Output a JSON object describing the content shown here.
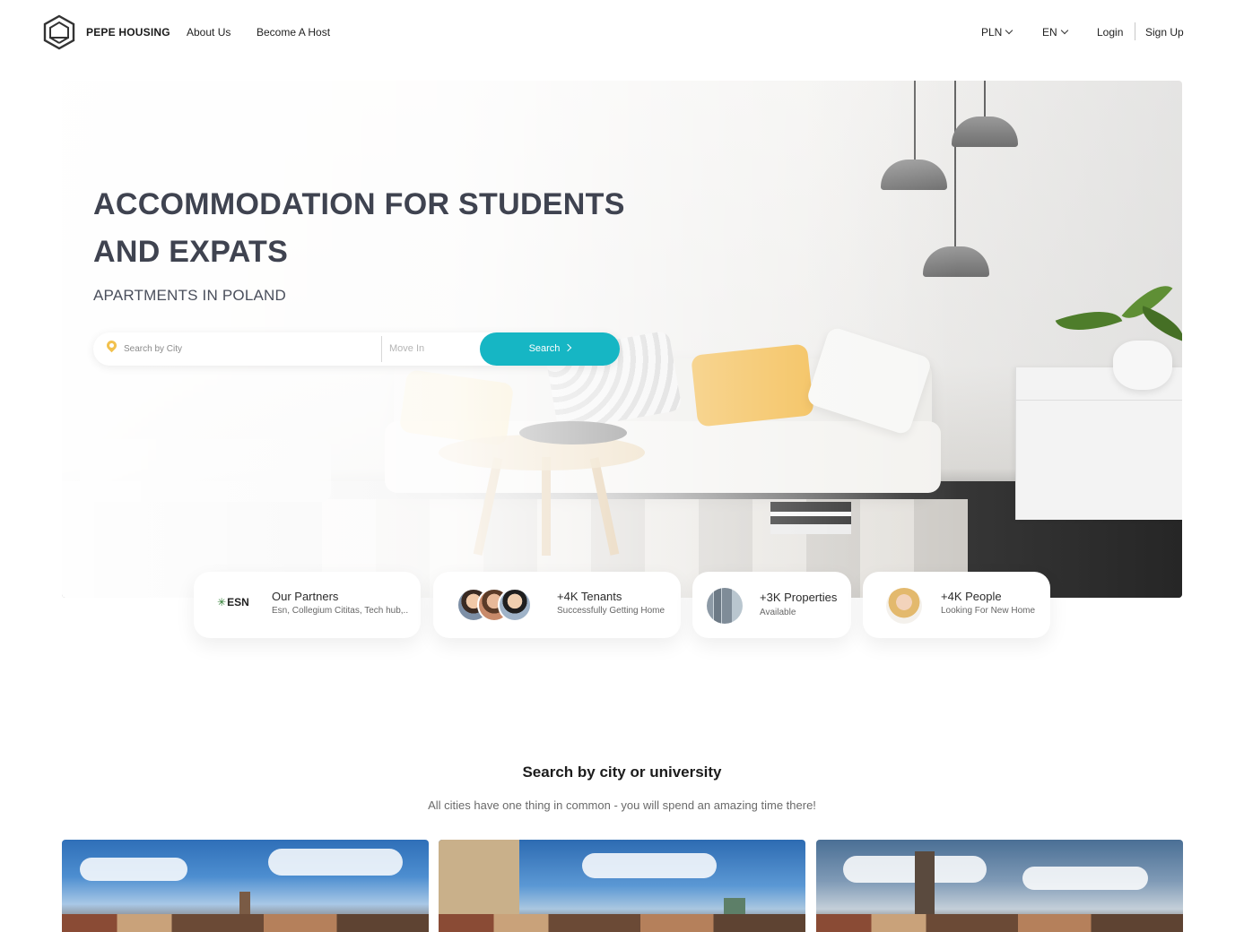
{
  "nav": {
    "brand": "PEPE HOUSING",
    "links": [
      "About Us",
      "Become A Host"
    ],
    "currency": "PLN",
    "language": "EN",
    "login": "Login",
    "signup": "Sign Up"
  },
  "hero": {
    "title_line1": "ACCOMMODATION FOR STUDENTS",
    "title_line2": "AND EXPATS",
    "subtitle": "APARTMENTS IN POLAND"
  },
  "search": {
    "city_placeholder": "Search by City",
    "movein_placeholder": "Move In",
    "button_label": "Search"
  },
  "stats": [
    {
      "logo_text": "ESN",
      "title": "Our Partners",
      "subtitle": "Esn, Collegium Cititas, Tech hub,.."
    },
    {
      "title": "+4K Tenants",
      "subtitle": "Successfully Getting Home"
    },
    {
      "title": "+3K Properties",
      "subtitle": "Available"
    },
    {
      "title": "+4K People",
      "subtitle": "Looking For New Home"
    }
  ],
  "section": {
    "title": "Search by city or university",
    "subtitle": "All cities have one thing in common - you will spend an amazing time there!"
  },
  "colors": {
    "accent": "#16b6c4",
    "heading": "#3f4350",
    "pin": "#f2c14e"
  },
  "icons": {
    "logo": "house-hexagon-icon",
    "location": "map-pin-icon",
    "chevron_down": "chevron-down-icon",
    "chevron_right": "chevron-right-icon"
  }
}
